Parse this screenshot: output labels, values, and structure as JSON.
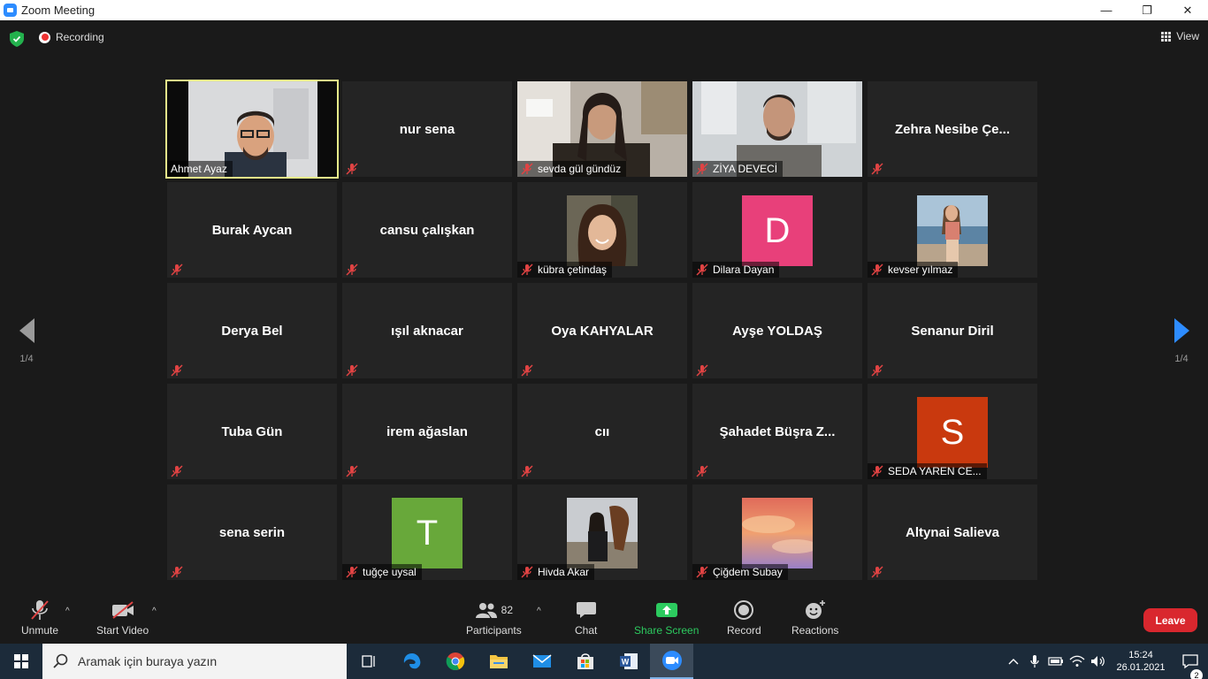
{
  "window": {
    "title": "Zoom Meeting",
    "minimize": "—",
    "maximize": "❐",
    "close": "✕"
  },
  "header": {
    "recording": "Recording",
    "view": "View"
  },
  "paging": {
    "left": "1/4",
    "right": "1/4"
  },
  "participants": [
    {
      "name": "Ahmet Ayaz"
    },
    {
      "name": "nur sena"
    },
    {
      "name": "sevda gül gündüz"
    },
    {
      "name": "ZİYA DEVECİ"
    },
    {
      "name": "Zehra Nesibe Çe..."
    },
    {
      "name": "Burak Aycan"
    },
    {
      "name": "cansu çalışkan"
    },
    {
      "name": "kübra çetindaş"
    },
    {
      "name": "Dilara Dayan",
      "initial": "D",
      "color": "#e8407a"
    },
    {
      "name": "kevser yılmaz"
    },
    {
      "name": "Derya Bel"
    },
    {
      "name": "ışıl aknacar"
    },
    {
      "name": "Oya KAHYALAR"
    },
    {
      "name": "Ayşe YOLDAŞ"
    },
    {
      "name": "Senanur Diril"
    },
    {
      "name": "Tuba Gün"
    },
    {
      "name": "irem ağaslan"
    },
    {
      "name": "cıı"
    },
    {
      "name": "Şahadet Büşra Z..."
    },
    {
      "name": "SEDA YAREN CE...",
      "initial": "S",
      "color": "#c9390e"
    },
    {
      "name": "sena serin"
    },
    {
      "name": "tuğçe uysal",
      "initial": "T",
      "color": "#68a83a"
    },
    {
      "name": "Hivda Akar"
    },
    {
      "name": "Çiğdem Subay"
    },
    {
      "name": "Altynai Salieva"
    }
  ],
  "toolbar": {
    "unmute": "Unmute",
    "start_video": "Start Video",
    "participants": "Participants",
    "participant_count": "82",
    "chat": "Chat",
    "share_screen": "Share Screen",
    "record": "Record",
    "reactions": "Reactions",
    "leave": "Leave"
  },
  "taskbar": {
    "search_placeholder": "Aramak için buraya yazın",
    "time": "15:24",
    "date": "26.01.2021",
    "notifications": "2"
  },
  "colors": {
    "accent": "#2D8CFF",
    "share": "#2ccb5f",
    "leave": "#d9272e",
    "active_border": "#e6ea8a"
  }
}
